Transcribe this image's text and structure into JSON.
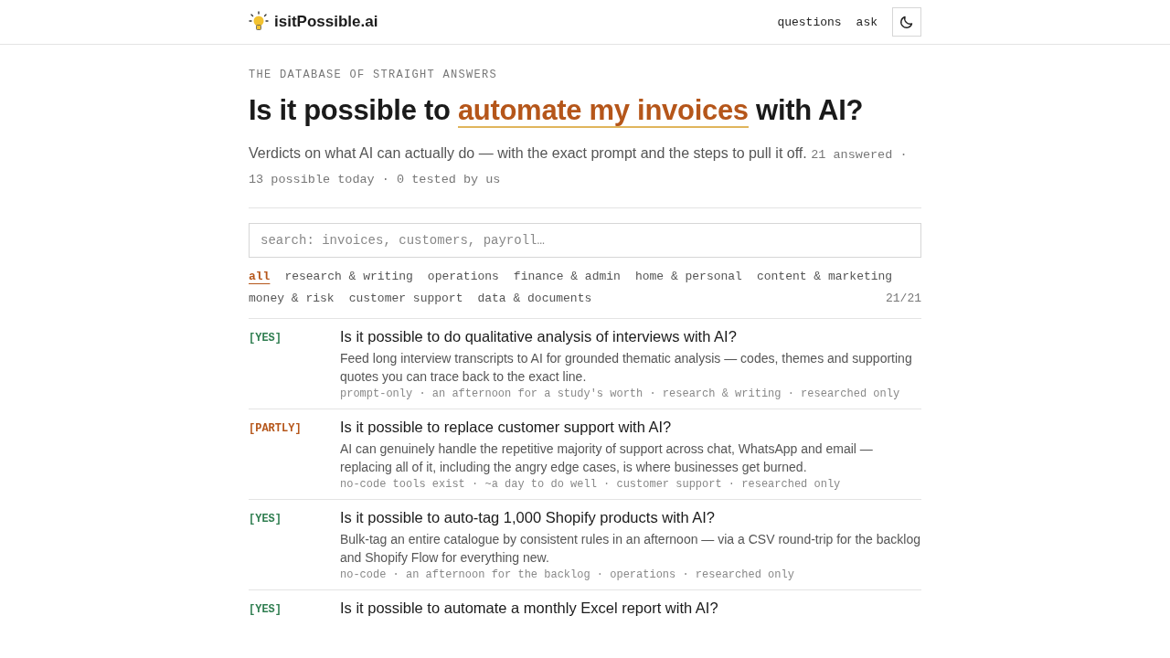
{
  "header": {
    "brand": "isitPossible.ai",
    "nav": [
      "questions",
      "ask"
    ]
  },
  "eyebrow": "THE DATABASE OF STRAIGHT ANSWERS",
  "headline": {
    "before": "Is it possible to",
    "highlight": "automate my invoices",
    "after": "with AI?"
  },
  "intro": {
    "text": "Verdicts on what AI can actually do — with the exact prompt and the steps to pull it off.",
    "stats": "21 answered · 13 possible today · 0 tested by us"
  },
  "search": {
    "placeholder": "search: invoices, customers, payroll…"
  },
  "filters": [
    {
      "label": "all",
      "selected": true
    },
    {
      "label": "research & writing",
      "selected": false
    },
    {
      "label": "operations",
      "selected": false
    },
    {
      "label": "finance & admin",
      "selected": false
    },
    {
      "label": "home & personal",
      "selected": false
    },
    {
      "label": "content & marketing",
      "selected": false
    },
    {
      "label": "money & risk",
      "selected": false
    },
    {
      "label": "customer support",
      "selected": false
    },
    {
      "label": "data & documents",
      "selected": false
    }
  ],
  "count": "21/21",
  "questions": [
    {
      "verdict": "[YES]",
      "kind": "yes",
      "title": "Is it possible to do qualitative analysis of interviews with AI?",
      "summary": "Feed long interview transcripts to AI for grounded thematic analysis — codes, themes and supporting quotes you can trace back to the exact line.",
      "meta": "prompt-only · an afternoon for a study's worth · research & writing · researched only"
    },
    {
      "verdict": "[PARTLY]",
      "kind": "partly",
      "title": "Is it possible to replace customer support with AI?",
      "summary": "AI can genuinely handle the repetitive majority of support across chat, WhatsApp and email — replacing all of it, including the angry edge cases, is where businesses get burned.",
      "meta": "no-code tools exist · ~a day to do well · customer support · researched only"
    },
    {
      "verdict": "[YES]",
      "kind": "yes",
      "title": "Is it possible to auto-tag 1,000 Shopify products with AI?",
      "summary": "Bulk-tag an entire catalogue by consistent rules in an afternoon — via a CSV round-trip for the backlog and Shopify Flow for everything new.",
      "meta": "no-code · an afternoon for the backlog · operations · researched only"
    },
    {
      "verdict": "[YES]",
      "kind": "yes",
      "title": "Is it possible to automate a monthly Excel report with AI?"
    }
  ]
}
